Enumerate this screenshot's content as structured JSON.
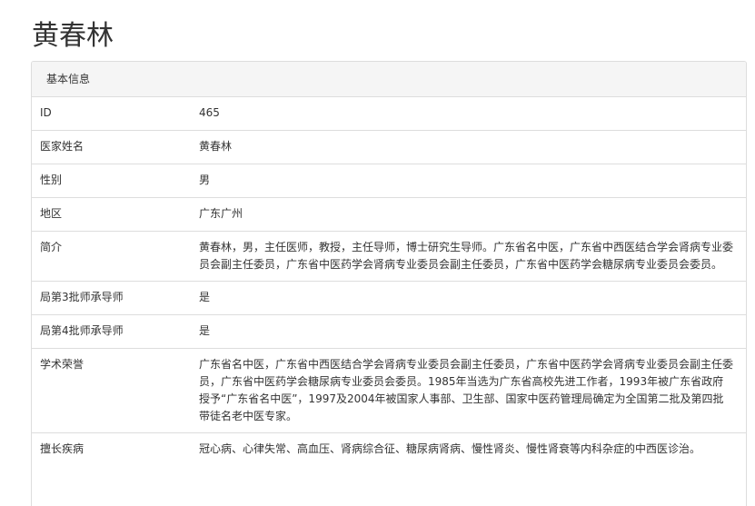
{
  "doctor_name": "黄春林",
  "panel": {
    "heading": "基本信息"
  },
  "rows": [
    {
      "key": "ID",
      "value": "465"
    },
    {
      "key": "医家姓名",
      "value": "黄春林"
    },
    {
      "key": "性别",
      "value": "男"
    },
    {
      "key": "地区",
      "value": "广东广州"
    },
    {
      "key": "简介",
      "value": "黄春林，男，主任医师，教授，主任导师，博士研究生导师。广东省名中医，广东省中西医结合学会肾病专业委员会副主任委员，广东省中医药学会肾病专业委员会副主任委员，广东省中医药学会糖尿病专业委员会委员。"
    },
    {
      "key": "局第3批师承导师",
      "value": "是"
    },
    {
      "key": "局第4批师承导师",
      "value": "是"
    },
    {
      "key": "学术荣誉",
      "value": "广东省名中医，广东省中西医结合学会肾病专业委员会副主任委员，广东省中医药学会肾病专业委员会副主任委员，广东省中医药学会糖尿病专业委员会委员。1985年当选为广东省高校先进工作者，1993年被广东省政府授予“广东省名中医”，1997及2004年被国家人事部、卫生部、国家中医药管理局确定为全国第二批及第四批带徒名老中医专家。"
    },
    {
      "key": "擅长疾病",
      "value": "冠心病、心律失常、高血压、肾病综合征、糖尿病肾病、慢性肾炎、慢性肾衰等内科杂症的中西医诊治。"
    }
  ]
}
